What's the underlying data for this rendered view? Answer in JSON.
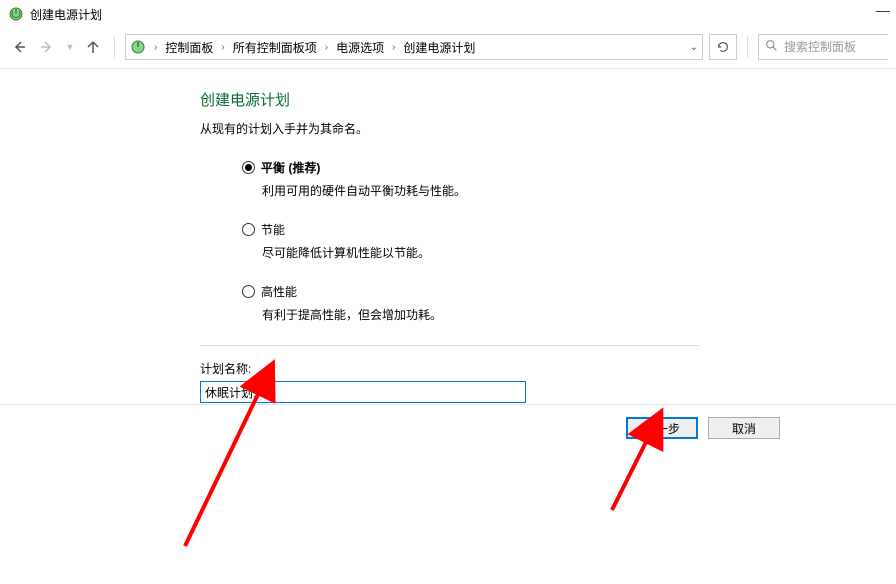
{
  "window": {
    "title": "创建电源计划",
    "minimize": "—"
  },
  "breadcrumb": {
    "items": [
      "控制面板",
      "所有控制面板项",
      "电源选项",
      "创建电源计划"
    ]
  },
  "search": {
    "placeholder": "搜索控制面板"
  },
  "page": {
    "title": "创建电源计划",
    "subtitle": "从现有的计划入手并为其命名。"
  },
  "options": [
    {
      "label": "平衡 (推荐)",
      "desc": "利用可用的硬件自动平衡功耗与性能。",
      "checked": true,
      "bold": true
    },
    {
      "label": "节能",
      "desc": "尽可能降低计算机性能以节能。",
      "checked": false,
      "bold": false
    },
    {
      "label": "高性能",
      "desc": "有利于提高性能，但会增加功耗。",
      "checked": false,
      "bold": false
    }
  ],
  "plan": {
    "name_label": "计划名称:",
    "value": "休眠计划1"
  },
  "buttons": {
    "next": "下一步",
    "cancel": "取消"
  }
}
